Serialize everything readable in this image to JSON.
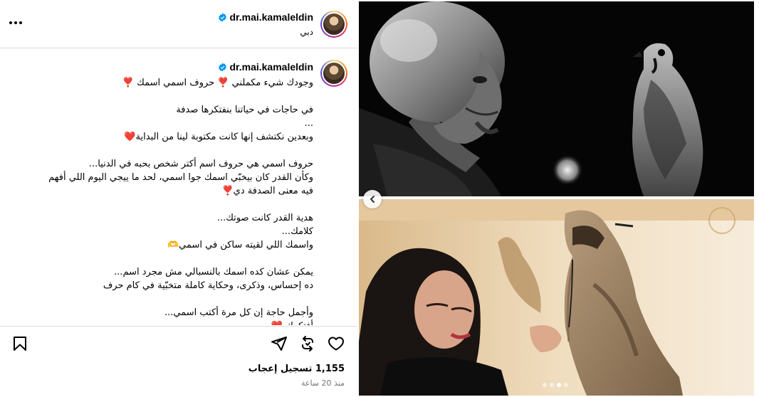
{
  "post": {
    "username": "dr.mai.kamaleldin",
    "location": "دبي",
    "caption_username": "dr.mai.kamaleldin"
  },
  "caption_lines": [
    "وجودك شيء مكملني ❣️ حروف اسمي اسمك ❣️",
    "",
    "في حاجات في حياتنا بنفتكرها صدفة",
    "...",
    "وبعدين نكتشف إنها كانت مكتوبة لينا من البداية❤️",
    "",
    "حروف اسمي هي حروف اسم أكتر شخص بحبه في الدنيا...",
    "وكأن القدر كان بيخبّي اسمك جوا اسمي، لحد ما ييجي اليوم اللي أفهم",
    "فيه معنى الصدفة دي❣️",
    "",
    "هدية القدر كانت صوتك...",
    "كلامك...",
    "واسمك اللي لقيته ساكن في اسمي🫶",
    "",
    "يمكن عشان كده اسمك بالنسبالي مش مجرد اسم...",
    "ده إحساس، وذكرى، وحكاية كاملة متخبّية في كام حرف",
    "",
    "وأجمل حاجة إن كل مرة أكتب اسمي...",
    "أفتكرك ❤️"
  ],
  "engagement": {
    "likes": "1,155 تسجيل إعجاب",
    "time_ago": "منذ 20 ساعة"
  },
  "carousel": {
    "slide_count": 4,
    "active_index": 2
  },
  "colors": {
    "verified": "#0095f6",
    "divider": "#dbdbdb",
    "muted": "#737373"
  },
  "icons": {
    "more": "more-icon",
    "verified": "verified-icon",
    "bookmark": "bookmark-icon",
    "share": "share-icon",
    "repost": "repost-icon",
    "like": "heart-icon",
    "prev": "chevron-left-icon"
  }
}
